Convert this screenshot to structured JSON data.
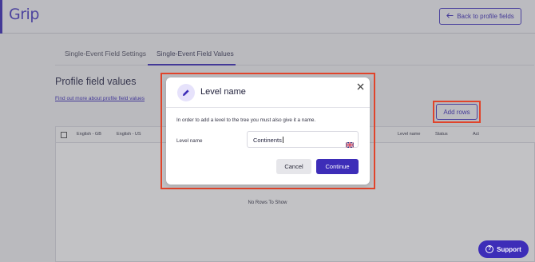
{
  "header": {
    "logo_text": "Grip",
    "back_button_label": "Back to profile fields"
  },
  "tabs": [
    {
      "label": "Single-Event Field Settings"
    },
    {
      "label": "Single-Event Field Values"
    }
  ],
  "main": {
    "page_title": "Profile field values",
    "help_link": "Find out more about profile field values",
    "add_rows_label": "Add rows"
  },
  "grid": {
    "columns": [
      "English - GB",
      "English - US",
      "Level name",
      "Status",
      "Act"
    ],
    "empty_text": "No Rows To Show"
  },
  "modal": {
    "title": "Level name",
    "description": "In order to add a level to the tree you must also give it a name.",
    "field_label": "Level name",
    "field_value": "Continents",
    "cancel_label": "Cancel",
    "continue_label": "Continue"
  },
  "support": {
    "label": "Support"
  },
  "colors": {
    "brand": "#3d2db8",
    "highlight": "#e0442b"
  }
}
